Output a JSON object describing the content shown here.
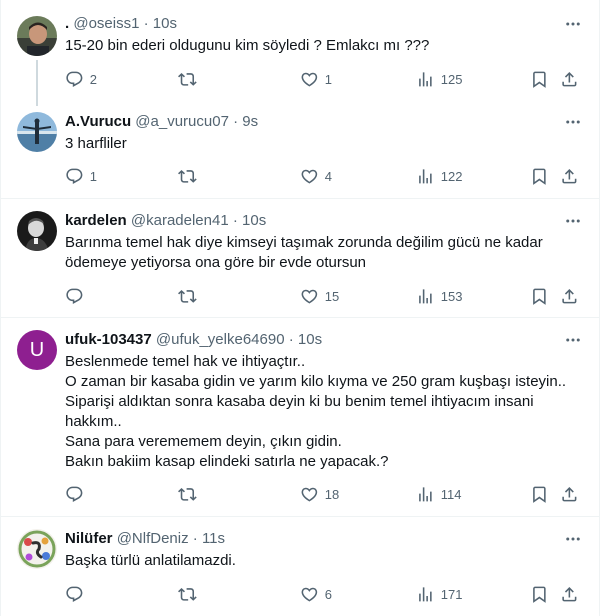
{
  "tweets": [
    {
      "name": ".",
      "handle": "@oseiss1",
      "dot": "·",
      "time": "10s",
      "text": "15-20 bin ederi oldugunu kim söyledi ? Emlakcı mı ???",
      "replies": "2",
      "retweets": "",
      "likes": "1",
      "views": "125"
    },
    {
      "name": "A.Vurucu",
      "handle": "@a_vurucu07",
      "dot": "·",
      "time": "9s",
      "text": "3 harfliler",
      "replies": "1",
      "retweets": "",
      "likes": "4",
      "views": "122"
    },
    {
      "name": "kardelen",
      "handle": "@karadelen41",
      "dot": "·",
      "time": "10s",
      "text": "Barınma temel hak diye kimseyi taşımak zorunda değilim gücü ne kadar ödemeye yetiyorsa ona göre bir evde otursun",
      "replies": "",
      "retweets": "",
      "likes": "15",
      "views": "153"
    },
    {
      "name": "ufuk-103437",
      "handle": "@ufuk_yelke64690",
      "dot": "·",
      "time": "10s",
      "avatar_letter": "U",
      "text": "Beslenmede temel hak ve ihtiyaçtır..\nO zaman bir kasaba gidin ve yarım kilo kıyma ve 250 gram kuşbaşı isteyin..\nSiparişi aldıktan sonra kasaba deyin ki bu benim temel ihtiyacım insani hakkım..\nSana para verememem deyin, çıkın gidin.\nBakın bakiim kasap elindeki satırla ne yapacak.?",
      "replies": "",
      "retweets": "",
      "likes": "18",
      "views": "114"
    },
    {
      "name": "Nilüfer",
      "handle": "@NlfDeniz",
      "dot": "·",
      "time": "11s",
      "text": "Başka türlü anlatilamazdi.",
      "replies": "",
      "retweets": "",
      "likes": "6",
      "views": "171"
    }
  ],
  "colors": {
    "text": "#0f1419",
    "secondary": "#536471",
    "border": "#eff3f4",
    "thread_line": "#cfd9de",
    "avatar_letter_bg": "#8e1f90"
  },
  "icons": [
    "more-icon",
    "reply-icon",
    "retweet-icon",
    "like-icon",
    "views-icon",
    "bookmark-icon",
    "share-icon"
  ]
}
